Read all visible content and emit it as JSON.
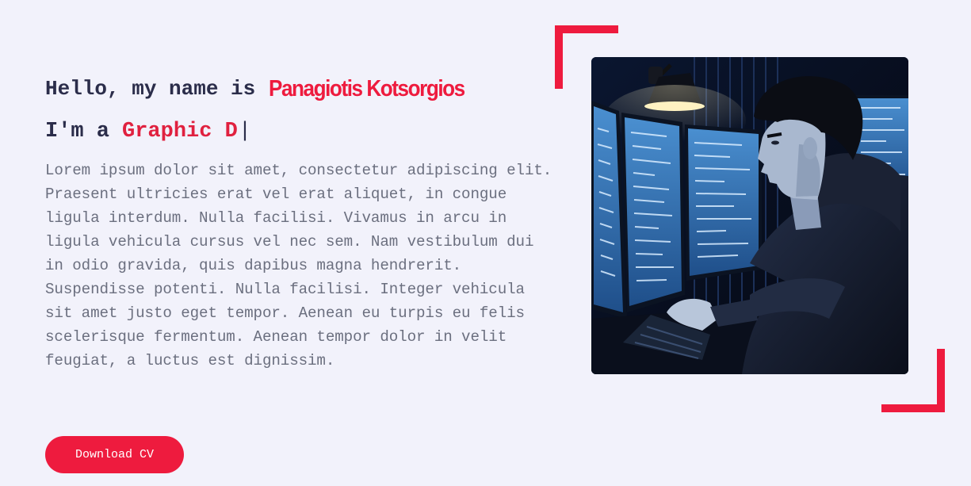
{
  "hero": {
    "greeting": "Hello, my name is",
    "name": "Panagiotis Kotsorgios",
    "role_prefix": "I'm a",
    "role_typed": "Graphic D",
    "cursor": "|",
    "bio": "Lorem ipsum dolor sit amet, consectetur adipiscing elit. Praesent ultricies erat vel erat aliquet, in congue ligula interdum. Nulla facilisi. Vivamus in arcu in ligula vehicula cursus vel nec sem. Nam vestibulum dui in odio gravida, quis dapibus magna hendrerit. Suspendisse potenti. Nulla facilisi. Integer vehicula sit amet justo eget tempor. Aenean eu turpis eu felis scelerisque fermentum. Aenean tempor dolor in velit feugiat, a luctus est dignissim."
  },
  "actions": {
    "download_cv": "Download CV"
  },
  "portrait": {
    "subject": "developer-at-computer-illustration"
  },
  "colors": {
    "accent": "#ee1b3e",
    "heading": "#2b2d4a",
    "body_text": "#6b6f7f",
    "background": "#f2f2fb"
  }
}
